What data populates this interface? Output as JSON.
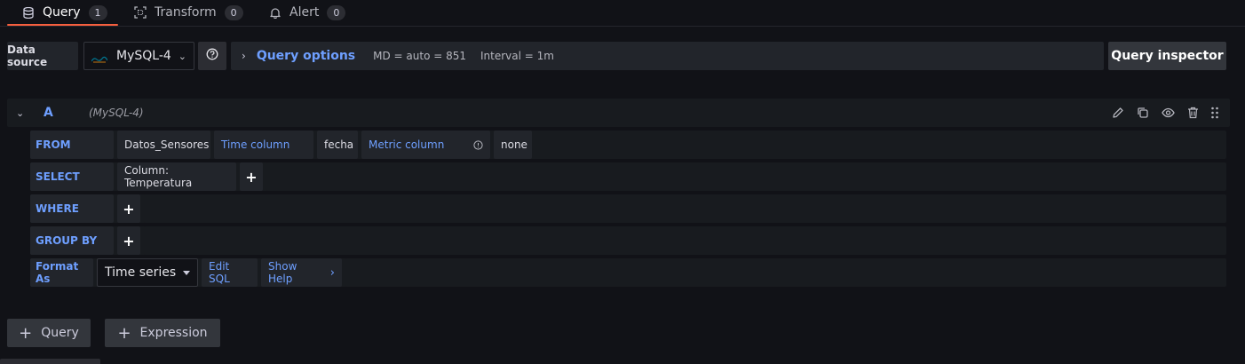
{
  "tabs": [
    {
      "label": "Query",
      "count": "1",
      "icon": "database-icon"
    },
    {
      "label": "Transform",
      "count": "0",
      "icon": "transform-icon"
    },
    {
      "label": "Alert",
      "count": "0",
      "icon": "bell-icon"
    }
  ],
  "toolbar": {
    "data_source_label": "Data source",
    "data_source_value": "MySQL-4",
    "query_options_label": "Query options",
    "md": "MD = auto = 851",
    "interval": "Interval = 1m",
    "inspector_label": "Query inspector"
  },
  "query": {
    "name": "A",
    "datasource": "(MySQL-4)"
  },
  "editor": {
    "from": {
      "keyword": "FROM",
      "table": "Datos_Sensores",
      "time_column_label": "Time column",
      "time_column_value": "fecha",
      "metric_column_label": "Metric column",
      "metric_column_value": "none"
    },
    "select": {
      "keyword": "SELECT",
      "column": "Column: Temperatura",
      "add": "+"
    },
    "where": {
      "keyword": "WHERE",
      "add": "+"
    },
    "group_by": {
      "keyword": "GROUP BY",
      "add": "+"
    },
    "format": {
      "keyword": "Format As",
      "value": "Time series",
      "edit_sql": "Edit SQL",
      "show_help": "Show Help"
    }
  },
  "bottom": {
    "add_query": "Query",
    "add_expression": "Expression"
  },
  "colors": {
    "accent_blue": "#6e9fff",
    "tab_active_underline": "#f55f3e",
    "background": "#111217"
  }
}
